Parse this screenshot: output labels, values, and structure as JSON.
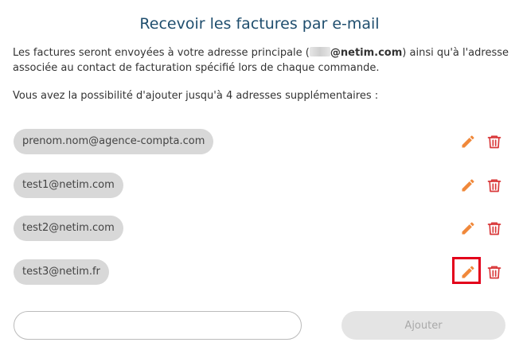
{
  "page": {
    "title": "Recevoir les factures par e-mail",
    "intro_before": "Les factures seront envoyées à votre adresse principale (",
    "intro_domain": "@netim.com",
    "intro_after": ") ainsi qu'à l'adresse associée au contact de facturation spécifié lors de chaque commande.",
    "limit_text": "Vous avez la possibilité d'ajouter jusqu'à 4 adresses supplémentaires :"
  },
  "emails": [
    "prenom.nom@agence-compta.com",
    "test1@netim.com",
    "test2@netim.com",
    "test3@netim.fr"
  ],
  "form": {
    "new_email_value": "",
    "add_label": "Ajouter"
  },
  "colors": {
    "title": "#1f4e6e",
    "chip_bg": "#d8d8d8",
    "edit_icon": "#f0883a",
    "delete_icon": "#d9383a",
    "highlight": "#e3001b",
    "button_bg": "#e4e4e4"
  },
  "icons": {
    "edit": "pencil-icon",
    "delete": "trash-icon"
  }
}
